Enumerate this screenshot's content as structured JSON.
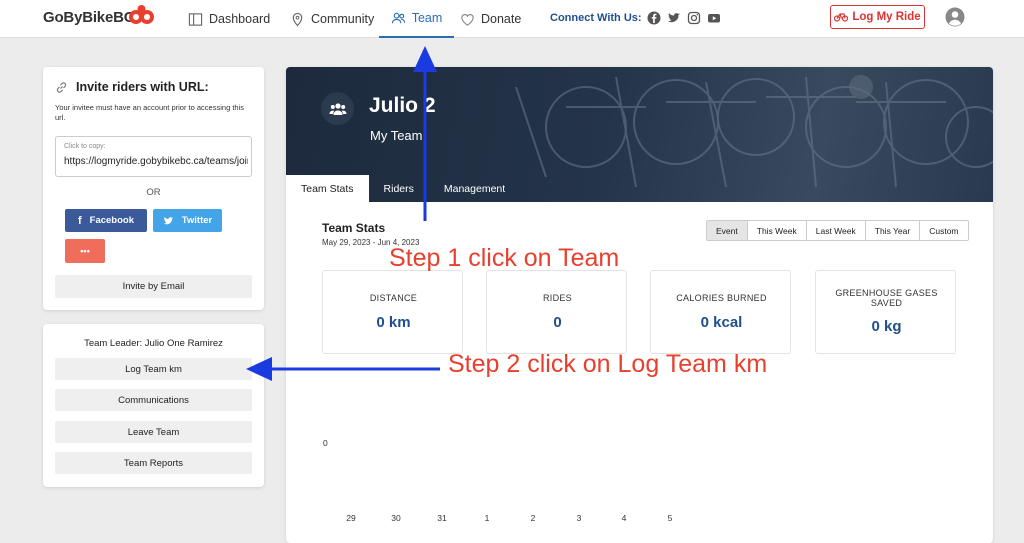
{
  "nav": {
    "brand": "GoByBikeBC",
    "items": [
      {
        "label": "Dashboard",
        "icon": "dashboard-icon"
      },
      {
        "label": "Community",
        "icon": "map-pin-icon"
      },
      {
        "label": "Team",
        "icon": "team-icon",
        "active": true
      },
      {
        "label": "Donate",
        "icon": "heart-icon"
      }
    ],
    "connect_label": "Connect With Us:",
    "log_ride_label": "Log My Ride"
  },
  "invite": {
    "title": "Invite riders with URL:",
    "note": "Your invitee must have an account prior to accessing this url.",
    "copy_hint": "Click to copy:",
    "url": "https://logmyride.gobybikebc.ca/teams/join",
    "or_label": "OR",
    "facebook_label": "Facebook",
    "twitter_label": "Twitter",
    "more_label": "•••",
    "email_label": "Invite by Email"
  },
  "leader": {
    "title": "Team Leader: Julio One Ramirez",
    "actions": [
      "Log Team km",
      "Communications",
      "Leave Team",
      "Team Reports"
    ]
  },
  "team": {
    "name": "Julio 2",
    "subtitle": "My Team",
    "tabs": [
      "Team Stats",
      "Riders",
      "Management"
    ]
  },
  "stats": {
    "title": "Team Stats",
    "date_range": "May 29, 2023 - Jun 4, 2023",
    "periods": [
      "Event",
      "This Week",
      "Last Week",
      "This Year",
      "Custom"
    ],
    "cards": [
      {
        "label": "DISTANCE",
        "value": "0 km"
      },
      {
        "label": "RIDES",
        "value": "0"
      },
      {
        "label": "CALORIES BURNED",
        "value": "0 kcal"
      },
      {
        "label": "GREENHOUSE GASES SAVED",
        "value": "0 kg"
      }
    ]
  },
  "chart_data": {
    "type": "bar",
    "categories": [
      "29",
      "30",
      "31",
      "1",
      "2",
      "3",
      "4",
      "5"
    ],
    "values": [
      0,
      0,
      0,
      0,
      0,
      0,
      0,
      0
    ],
    "y_tick_labels": [
      "0"
    ]
  },
  "annotations": {
    "step1": "Step 1 click on Team",
    "step2": "Step 2 click on Log Team km",
    "color": "#e8402f",
    "arrow_color": "#1a3be0"
  }
}
